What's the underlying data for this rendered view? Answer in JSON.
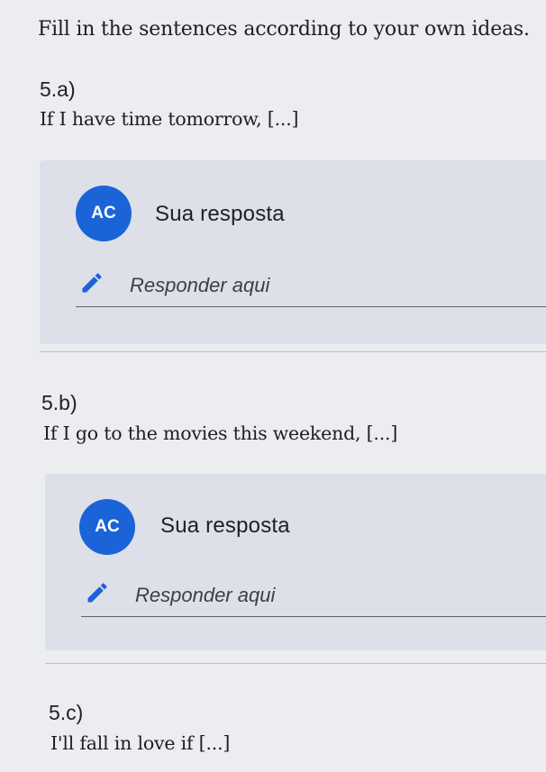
{
  "instructions": "Fill in the sentences according to your own ideas.",
  "questions": [
    {
      "number": "5.a)",
      "prompt": "If I have time tomorrow, [...]",
      "avatar": "AC",
      "response_label": "Sua resposta",
      "input_placeholder": "Responder aqui",
      "input_icon": "pencil-icon"
    },
    {
      "number": "5.b)",
      "prompt": "If I go to the movies this weekend, [...]",
      "avatar": "AC",
      "response_label": "Sua resposta",
      "input_placeholder": "Responder aqui",
      "input_icon": "pencil-icon"
    },
    {
      "number": "5.c)",
      "prompt": "I'll fall in love if [...]"
    }
  ],
  "colors": {
    "avatar_bg": "#1a64d8",
    "card_bg": "#dde0e8",
    "page_bg": "#ecedf1"
  }
}
